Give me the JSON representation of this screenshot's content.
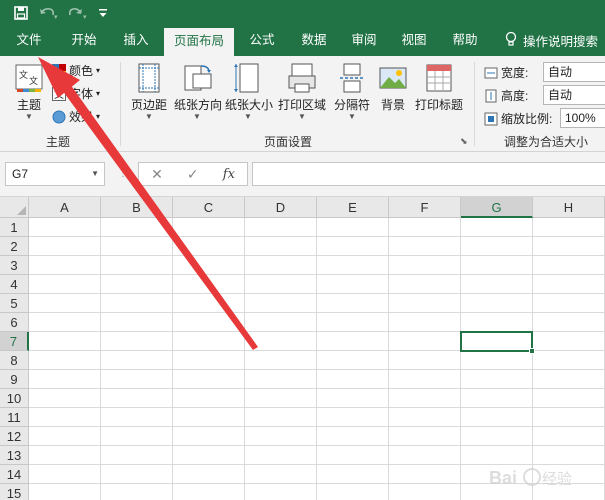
{
  "quick_access": {
    "save_icon": "save-icon",
    "undo_icon": "undo-icon",
    "redo_icon": "redo-icon",
    "customize_icon": "customize-qat-icon"
  },
  "tabs": [
    {
      "label": "文件"
    },
    {
      "label": "开始"
    },
    {
      "label": "插入"
    },
    {
      "label": "页面布局",
      "active": true
    },
    {
      "label": "公式"
    },
    {
      "label": "数据"
    },
    {
      "label": "审阅"
    },
    {
      "label": "视图"
    },
    {
      "label": "帮助"
    }
  ],
  "tell_me": "操作说明搜索",
  "ribbon": {
    "themes_group": {
      "label": "主题",
      "theme_button": "主题",
      "colors": "颜色",
      "fonts": "字体",
      "effects": "效果"
    },
    "page_setup_group": {
      "label": "页面设置",
      "margins": "页边距",
      "orientation": "纸张方向",
      "size": "纸张大小",
      "print_area": "打印区域",
      "breaks": "分隔符",
      "background": "背景",
      "print_titles": "打印标题"
    },
    "scale_group": {
      "label": "调整为合适大小",
      "width_label": "宽度:",
      "width_value": "自动",
      "height_label": "高度:",
      "height_value": "自动",
      "scale_label": "缩放比例:",
      "scale_value": "100%"
    }
  },
  "formula_bar": {
    "name_box": "G7",
    "cancel": "✕",
    "enter": "✓",
    "fx": "fx",
    "formula": ""
  },
  "sheet": {
    "columns": [
      "A",
      "B",
      "C",
      "D",
      "E",
      "F",
      "G",
      "H"
    ],
    "rows": [
      "1",
      "2",
      "3",
      "4",
      "5",
      "6",
      "7",
      "8",
      "9",
      "10",
      "11",
      "12",
      "13",
      "14",
      "15"
    ],
    "selected_column": "G",
    "selected_row": "7"
  },
  "watermark": "Bai du 经验",
  "colors": {
    "excel_green": "#217346",
    "arrow_red": "#e8393a"
  }
}
